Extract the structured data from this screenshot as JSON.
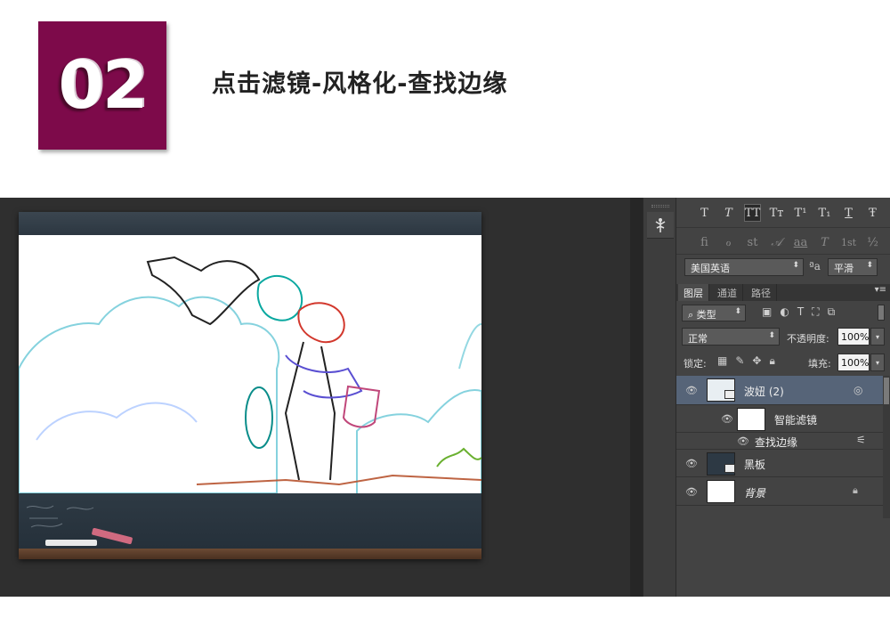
{
  "step": {
    "number": "02",
    "title": "点击滤镜-风格化-查找边缘"
  },
  "character_panel": {
    "row1": [
      "T",
      "T",
      "TT",
      "Tᴛ",
      "T¹",
      "T₁",
      "T",
      "Ŧ"
    ],
    "row2": [
      "ﬁ",
      "ℴ",
      "st",
      "𝒜",
      "aa",
      "T",
      "1st",
      "½"
    ],
    "language": "美国英语",
    "aa_icon": "ªa",
    "antialias": "平滑"
  },
  "layers_panel": {
    "tabs": [
      "图层",
      "通道",
      "路径"
    ],
    "filter_type": "类型",
    "blend_mode": "正常",
    "opacity_label": "不透明度:",
    "opacity_value": "100%",
    "lock_label": "锁定:",
    "fill_label": "填充:",
    "fill_value": "100%",
    "layers": [
      {
        "name": "波妞 (2)",
        "selected": true
      },
      {
        "name": "智能滤镜"
      },
      {
        "name": "查找边缘"
      },
      {
        "name": "黑板"
      },
      {
        "name": "背景",
        "locked": true
      }
    ]
  },
  "colors": {
    "badge": "#7d0a4a",
    "selected_layer": "#566478",
    "panel": "#434343"
  }
}
